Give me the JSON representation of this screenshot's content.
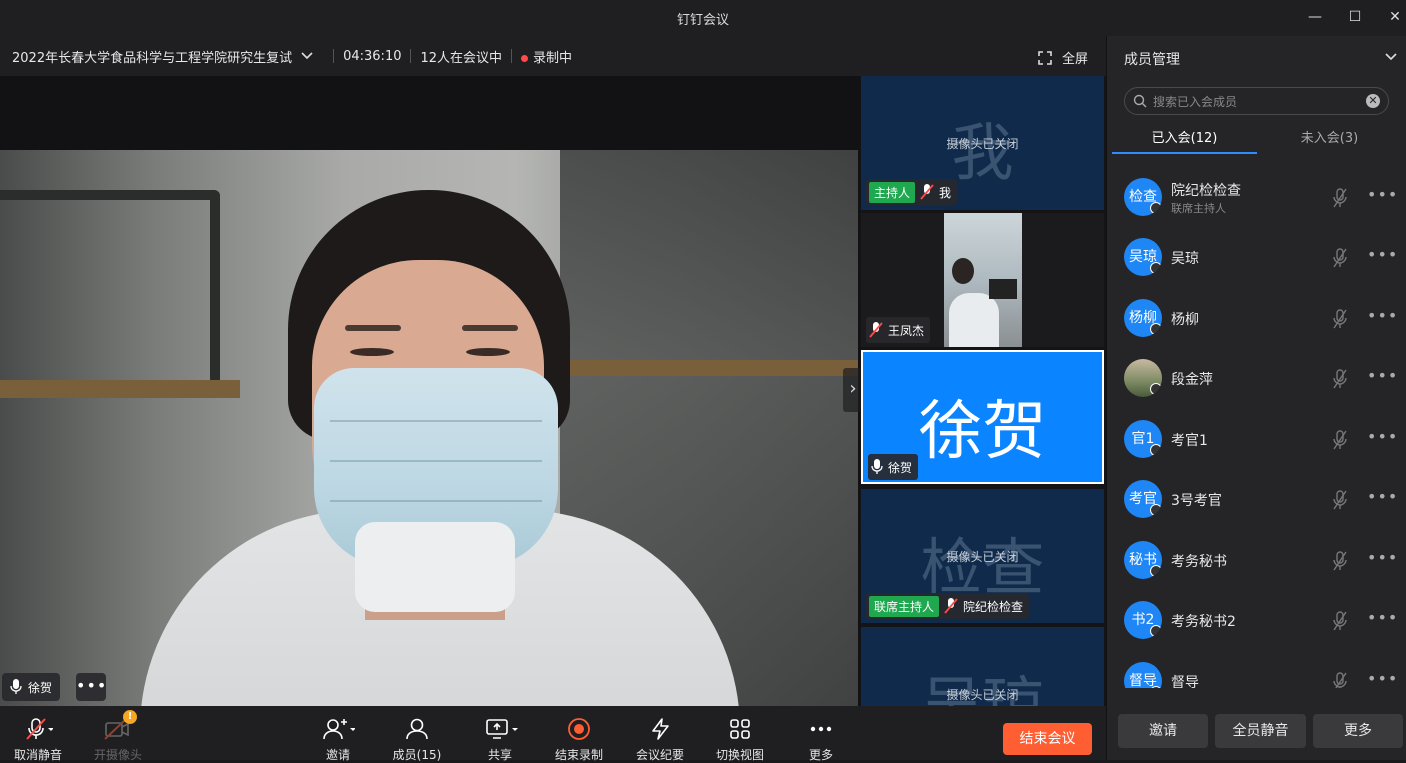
{
  "window": {
    "title": "钉钉会议",
    "minimize": "—",
    "maximize": "☐",
    "close": "✕"
  },
  "meeting": {
    "topic": "2022年长春大学食品科学与工程学院研究生复试",
    "duration": "04:36:10",
    "participants_in": "12人在会议中",
    "recording": "录制中",
    "fullscreen_label": "全屏"
  },
  "main_video": {
    "speaker_name": "徐贺",
    "more": "•••"
  },
  "tiles": [
    {
      "big_char": "我",
      "cam_status": "摄像头已关闭",
      "role_tag": "主持人",
      "name": "我",
      "muted": true
    },
    {
      "name": "王凤杰",
      "muted": true,
      "has_video": true
    },
    {
      "big_char": "徐贺",
      "name": "徐贺",
      "muted": false,
      "active": true
    },
    {
      "big_char": "检查",
      "cam_status": "摄像头已关闭",
      "role_tag": "联席主持人",
      "name": "院纪检检查",
      "muted": true
    },
    {
      "big_char": "吴琼",
      "cam_status": "摄像头已关闭"
    }
  ],
  "toolbar": {
    "unmute": "取消静音",
    "camera": "开摄像头",
    "invite": "邀请",
    "members": "成员(15)",
    "share": "共享",
    "stop_record": "结束录制",
    "minutes": "会议纪要",
    "switch_view": "切换视图",
    "more": "更多",
    "end_meeting": "结束会议"
  },
  "panel": {
    "title": "成员管理",
    "search_placeholder": "搜索已入会成员",
    "tab_joined": "已入会(12)",
    "tab_not_joined": "未入会(3)",
    "members": [
      {
        "avatar": "检查",
        "name": "院纪检检查",
        "sub": "联席主持人"
      },
      {
        "avatar": "吴琼",
        "name": "吴琼"
      },
      {
        "avatar": "杨柳",
        "name": "杨柳"
      },
      {
        "avatar": "",
        "name": "段金萍",
        "photo": true
      },
      {
        "avatar": "官1",
        "name": "考官1"
      },
      {
        "avatar": "考官",
        "name": "3号考官"
      },
      {
        "avatar": "秘书",
        "name": "考务秘书"
      },
      {
        "avatar": "书2",
        "name": "考务秘书2"
      },
      {
        "avatar": "督导",
        "name": "督导"
      }
    ],
    "btn_invite": "邀请",
    "btn_mute_all": "全员静音",
    "btn_more": "更多"
  },
  "colors": {
    "accent_blue": "#1f86f5",
    "end_button": "#ff5e33",
    "host_tag": "#1fa84f",
    "record_dot": "#ff4a4a",
    "tile_bg": "#0f2a4a"
  },
  "icons": [
    "mic-muted-icon",
    "camera-off-icon",
    "warning-icon",
    "invite-user-icon",
    "members-icon",
    "share-screen-icon",
    "record-stop-icon",
    "minutes-icon",
    "grid-view-icon",
    "more-icon",
    "search-icon",
    "chevron-down-icon",
    "fullscreen-icon"
  ]
}
